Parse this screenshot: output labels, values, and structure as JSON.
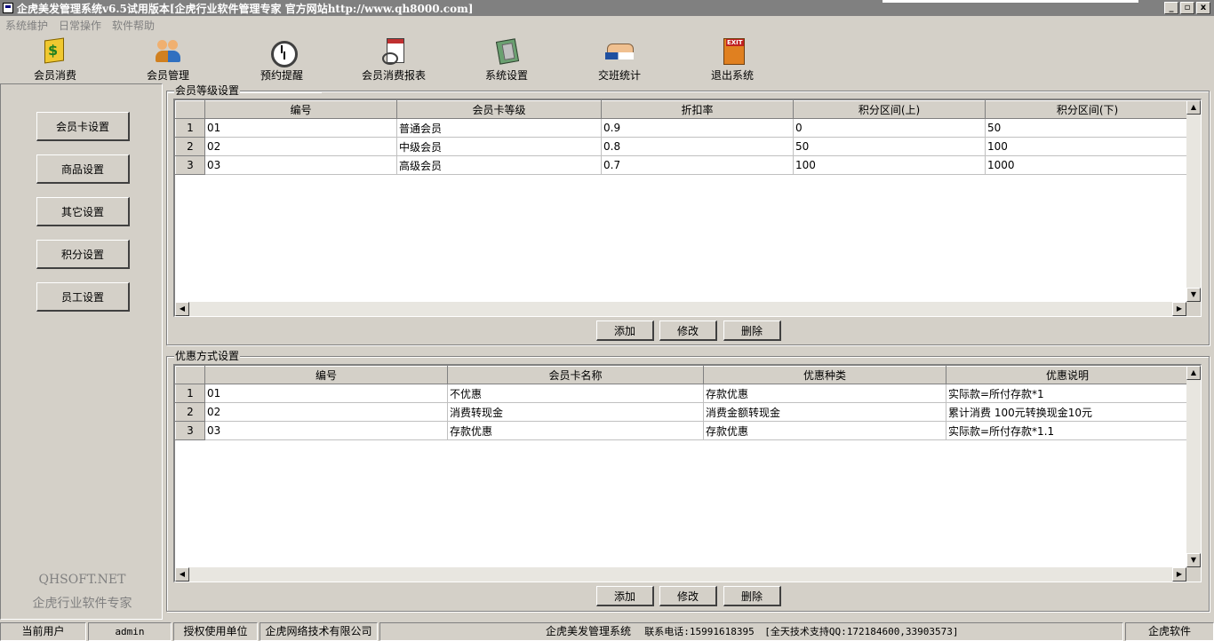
{
  "window": {
    "title": "企虎美发管理系统v6.5试用版本[企虎行业软件管理专家 官方网站http://www.qh8000.com]",
    "buttons": [
      "_",
      "▫",
      "x"
    ]
  },
  "menu": [
    "系统维护",
    "日常操作",
    "软件帮助"
  ],
  "toolbar": [
    {
      "label": "会员消费",
      "icon": "consume-icon"
    },
    {
      "label": "会员管理",
      "icon": "members-icon"
    },
    {
      "label": "预约提醒",
      "icon": "alarm-clock-icon"
    },
    {
      "label": "会员消费报表",
      "icon": "report-icon"
    },
    {
      "label": "系统设置",
      "icon": "settings-icon"
    },
    {
      "label": "交班统计",
      "icon": "handshake-icon"
    },
    {
      "label": "退出系统",
      "icon": "exit-icon"
    }
  ],
  "sidebar": {
    "buttons": [
      "会员卡设置",
      "商品设置",
      "其它设置",
      "积分设置",
      "员工设置"
    ],
    "brand_en": "QHSOFT.NET",
    "brand_cn": "企虎行业软件专家"
  },
  "levels": {
    "title": "会员等级设置",
    "columns": [
      "编号",
      "会员卡等级",
      "折扣率",
      "积分区间(上)",
      "积分区间(下)"
    ],
    "rows": [
      [
        "01",
        "普通会员",
        "0.9",
        "0",
        "50"
      ],
      [
        "02",
        "中级会员",
        "0.8",
        "50",
        "100"
      ],
      [
        "03",
        "高级会员",
        "0.7",
        "100",
        "1000"
      ]
    ],
    "row_numbers": [
      "1",
      "2",
      "3"
    ],
    "actions": [
      "添加",
      "修改",
      "删除"
    ]
  },
  "discounts": {
    "title": "优惠方式设置",
    "columns": [
      "编号",
      "会员卡名称",
      "优惠种类",
      "优惠说明"
    ],
    "rows": [
      [
        "01",
        "不优惠",
        "存款优惠",
        "实际款=所付存款*1"
      ],
      [
        "02",
        "消费转现金",
        "消费金额转现金",
        "累计消费 100元转换现金10元"
      ],
      [
        "03",
        "存款优惠",
        "存款优惠",
        "实际款=所付存款*1.1"
      ]
    ],
    "row_numbers": [
      "1",
      "2",
      "3"
    ],
    "actions": [
      "添加",
      "修改",
      "删除"
    ]
  },
  "status": {
    "current_user_label": "当前用户",
    "current_user": "admin",
    "licensed_label": "授权使用单位",
    "licensed_unit": "企虎网络技术有限公司",
    "system_name": "企虎美发管理系统",
    "phone": "联系电话:15991618395",
    "support": "[全天技术支持QQ:172184600,33903573]",
    "vendor": "企虎软件"
  }
}
